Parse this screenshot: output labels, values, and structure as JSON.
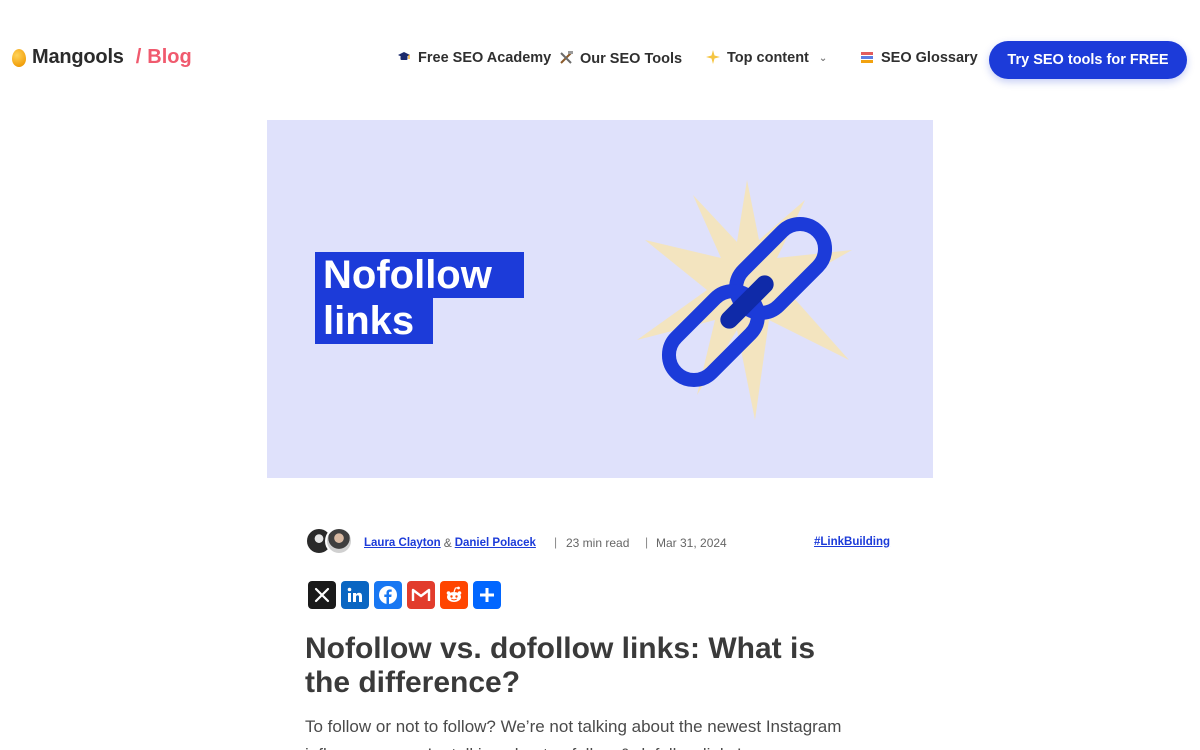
{
  "brand": {
    "name": "Mangools",
    "separator": "/",
    "section": "Blog"
  },
  "nav": {
    "items": [
      {
        "label": "Free SEO Academy",
        "icon": "graduation-cap-icon"
      },
      {
        "label": "Our SEO Tools",
        "icon": "tools-icon"
      },
      {
        "label": "Top content",
        "icon": "sparkle-icon",
        "has_dropdown": true
      },
      {
        "label": "SEO Glossary",
        "icon": "books-icon"
      }
    ],
    "cta_label": "Try SEO tools for FREE"
  },
  "hero": {
    "title_line1": "Nofollow",
    "title_line2": "links",
    "image_icon": "broken-chain-link-icon"
  },
  "meta": {
    "author1": "Laura Clayton",
    "and": "&",
    "author2": "Daniel Polacek",
    "sep": "|",
    "read_time": "23 min read",
    "date": "Mar 31, 2024",
    "tag": "#LinkBuilding"
  },
  "share": {
    "buttons": [
      {
        "network": "X",
        "icon": "x-icon",
        "color": "#1a1a1a"
      },
      {
        "network": "LinkedIn",
        "icon": "linkedin-icon",
        "color": "#0a66c2"
      },
      {
        "network": "Facebook",
        "icon": "facebook-icon",
        "color": "#1877f2"
      },
      {
        "network": "Gmail",
        "icon": "gmail-icon",
        "color": "#e23c2c"
      },
      {
        "network": "Reddit",
        "icon": "reddit-icon",
        "color": "#ff4500"
      },
      {
        "network": "Share",
        "icon": "share-plus-icon",
        "color": "#0166ff"
      }
    ]
  },
  "article": {
    "title": "Nofollow vs. dofollow links: What is the difference?",
    "intro": "To follow or not to follow? We’re not talking about the newest Instagram influencers – we’re talking about nofollow & dofollow links!"
  },
  "colors": {
    "accent": "#1c3bd9",
    "brand_pink": "#f05a6e",
    "hero_bg": "#dfe1fb",
    "burst": "#f5e4b8"
  }
}
